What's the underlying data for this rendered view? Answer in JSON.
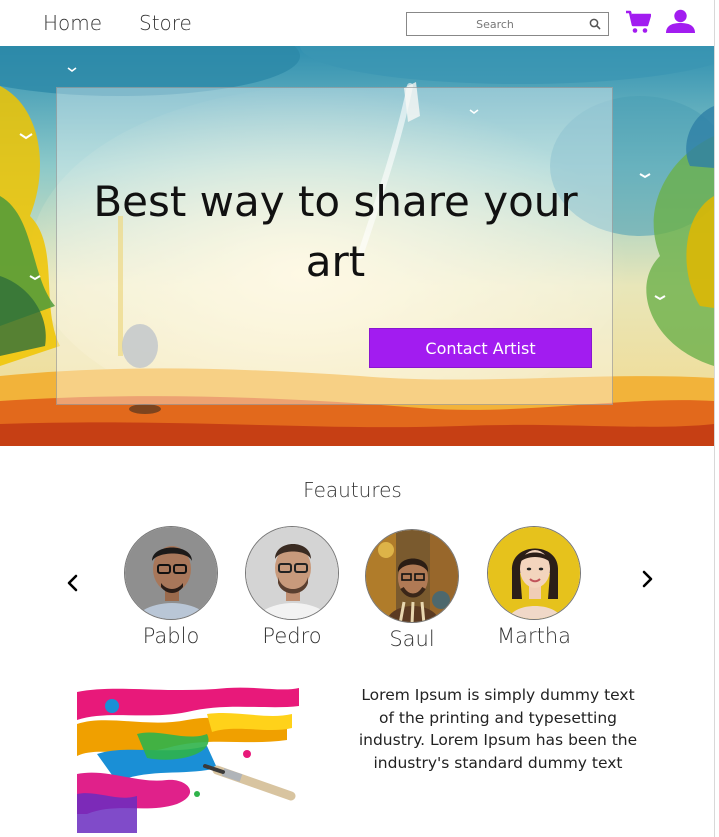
{
  "nav": {
    "links": [
      {
        "label": "Home"
      },
      {
        "label": "Store"
      }
    ],
    "search": {
      "placeholder": "Search",
      "value": ""
    },
    "icons": [
      "search-icon",
      "cart-icon",
      "user-icon"
    ],
    "accent_color": "#a21cf0"
  },
  "hero": {
    "title": "Best way to share your art",
    "button_label": "Contact Artist"
  },
  "features": {
    "title": "Feautures",
    "artists": [
      {
        "name": "Pablo"
      },
      {
        "name": "Pedro"
      },
      {
        "name": "Saul"
      },
      {
        "name": "Martha"
      }
    ],
    "icons": [
      "chevron-left-icon",
      "chevron-right-icon"
    ]
  },
  "info": {
    "text": "Lorem Ipsum is simply dummy text of the printing and typesetting industry. Lorem Ipsum has been the industry's standard dummy text"
  }
}
